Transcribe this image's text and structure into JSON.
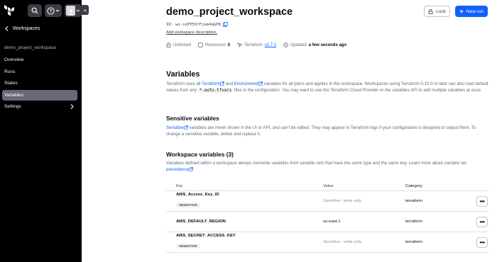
{
  "sidebar": {
    "back_label": "Workspaces",
    "workspace_heading": "demo_project_workspace",
    "items": [
      {
        "label": "Overview"
      },
      {
        "label": "Runs"
      },
      {
        "label": "States"
      },
      {
        "label": "Variables",
        "active": true
      },
      {
        "label": "Settings",
        "has_chevron": true
      }
    ],
    "collapse_icon": "«"
  },
  "header": {
    "title": "demo_project_workspace",
    "id_label": "ID:",
    "id_value": "ws-sqTP55fFjem4qGP8",
    "add_description": "Add workspace description.",
    "lock_label": "Lock",
    "new_run_label": "New run",
    "meta": {
      "lock_status": "Unlocked",
      "resources_label": "Resources",
      "resources_count": "0",
      "terraform_label": "Terraform",
      "terraform_version": "v1.7.1",
      "updated_label": "Updated",
      "updated_value": "a few seconds ago"
    }
  },
  "variables": {
    "heading": "Variables",
    "desc_1": "Terraform uses all",
    "desc_link_terraform": "Terraform",
    "desc_2": "and",
    "desc_link_environment": "Environment",
    "desc_3": "variables for all plans and applies in this workspace. Workspaces using Terraform 0.10.0 or later can also load default values from any",
    "desc_code": "*.auto.tfvars",
    "desc_4": "files in the configuration. You may want to use the Terraform Cloud Provider or the variables API to add multiple variables at once."
  },
  "sensitive": {
    "heading": "Sensitive variables",
    "link": "Sensitive",
    "desc": "variables are never shown in the UI or API, and can't be edited. They may appear in Terraform logs if your configuration is designed to output them. To change a sensitive variable, delete and replace it."
  },
  "workspace_vars": {
    "heading": "Workspace variables (3)",
    "desc": "Variables defined within a workspace always overwrite variables from variable sets that have the same type and the same key. Learn more about variable set",
    "link": "precedence",
    "columns": {
      "key": "Key",
      "value": "Value",
      "category": "Category"
    },
    "rows": [
      {
        "key": "AWS_Access_Key_ID",
        "badge": "SENSITIVE",
        "value": "Sensitive - write only",
        "category": "terraform"
      },
      {
        "key": "AWS_DEFAULT_REGION",
        "badge": "",
        "value": "us-east-1",
        "category": "terraform"
      },
      {
        "key": "AWS_SECRET_ACCESS_KEY",
        "badge": "SENSITIVE",
        "value": "Sensitive - write only",
        "category": "terraform"
      }
    ],
    "actions_label": "•••"
  },
  "colors": {
    "sidebar_bg": "#000000",
    "active_item": "#656a76",
    "primary": "#1060ff",
    "link": "#1060ff"
  }
}
